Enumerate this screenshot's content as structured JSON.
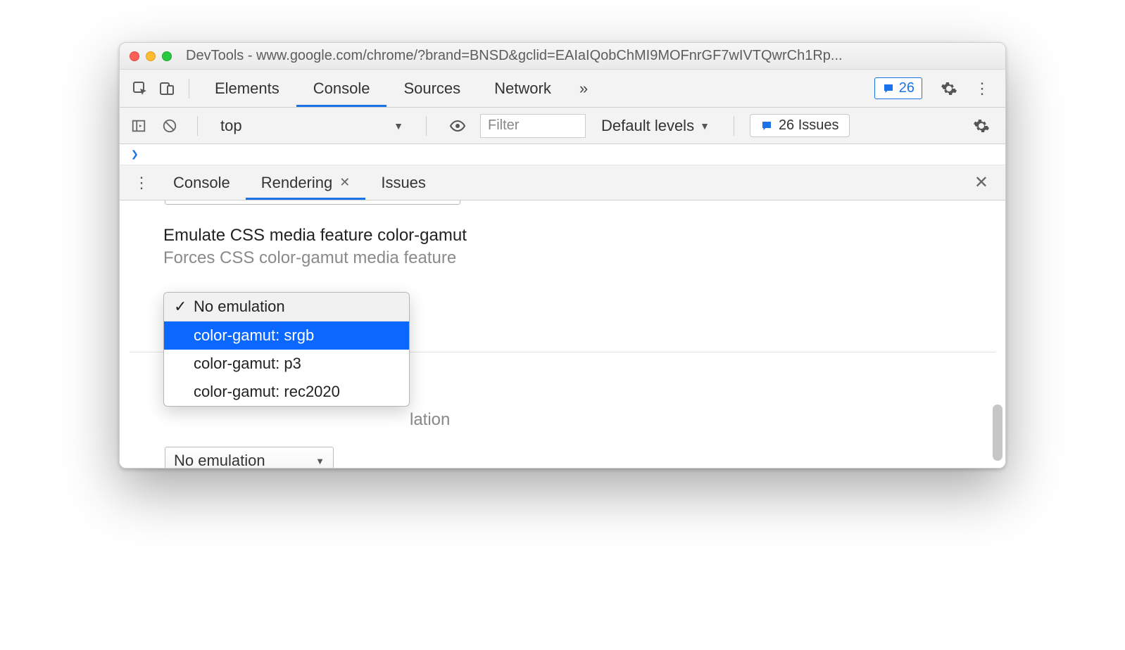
{
  "window": {
    "title": "DevTools - www.google.com/chrome/?brand=BNSD&gclid=EAIaIQobChMI9MOFnrGF7wIVTQwrCh1Rp..."
  },
  "tabs_main": {
    "items": [
      "Elements",
      "Console",
      "Sources",
      "Network"
    ],
    "active": 1,
    "issue_count_badge": "26"
  },
  "console_toolbar": {
    "context": "top",
    "filter_placeholder": "Filter",
    "levels_label": "Default levels",
    "issues_label": "26 Issues"
  },
  "drawer": {
    "tabs": [
      "Console",
      "Rendering",
      "Issues"
    ],
    "active": 1
  },
  "rendering": {
    "section_title": "Emulate CSS media feature color-gamut",
    "section_desc": "Forces CSS color-gamut media feature",
    "dropdown": {
      "options": [
        "No emulation",
        "color-gamut: srgb",
        "color-gamut: p3",
        "color-gamut: rec2020"
      ],
      "checked_index": 0,
      "highlight_index": 1
    },
    "below_section_desc_tail": "lation",
    "bottom_select_value": "No emulation"
  }
}
